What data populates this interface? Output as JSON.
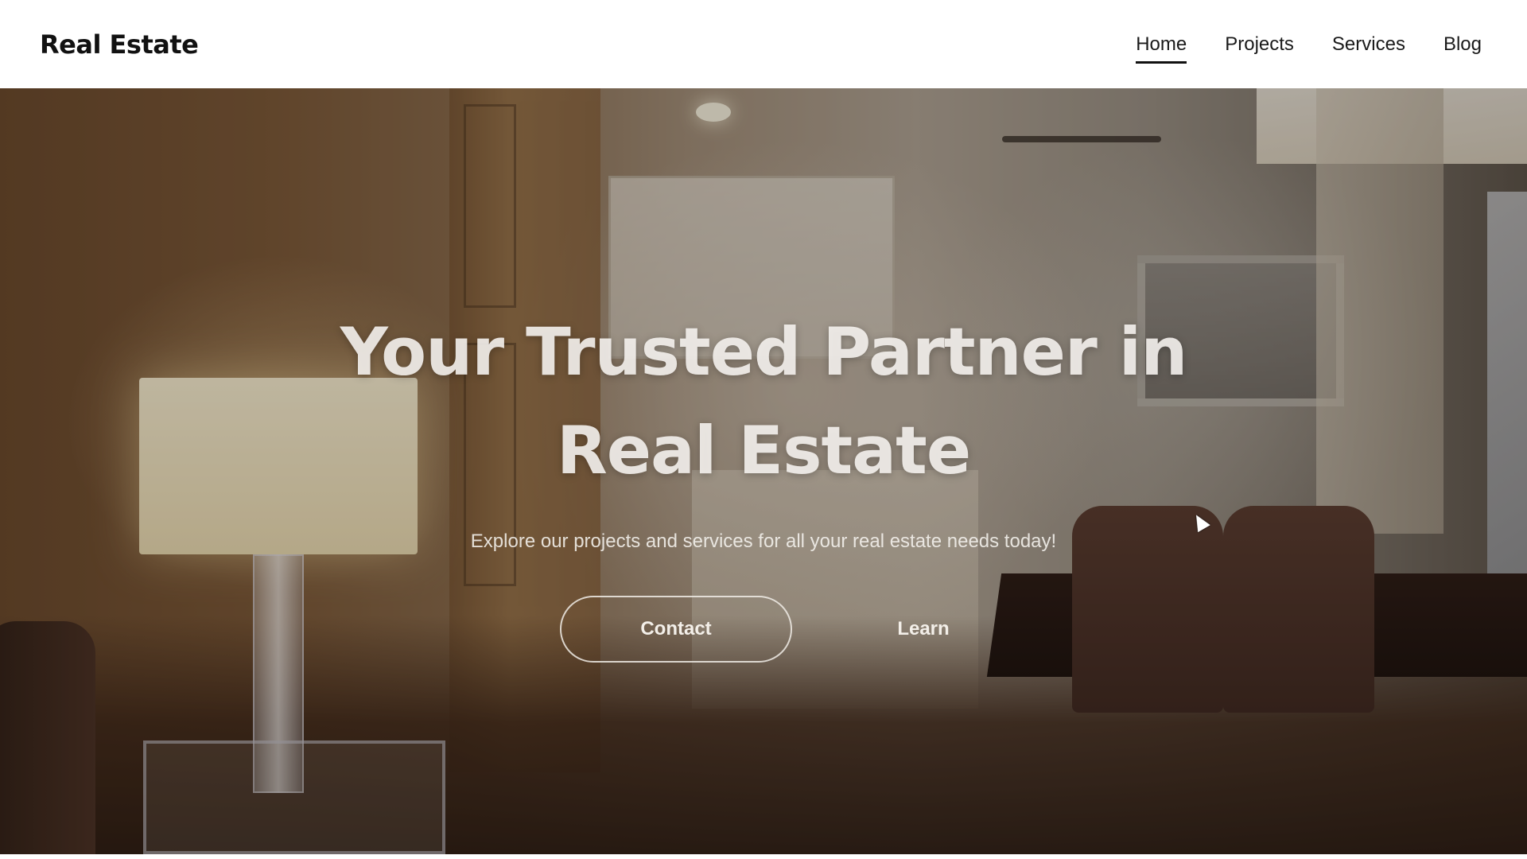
{
  "header": {
    "logo": "Real Estate",
    "nav": [
      {
        "label": "Home",
        "active": true
      },
      {
        "label": "Projects",
        "active": false
      },
      {
        "label": "Services",
        "active": false
      },
      {
        "label": "Blog",
        "active": false
      }
    ]
  },
  "hero": {
    "title": "Your Trusted Partner in Real Estate",
    "subtitle": "Explore our projects and services for all your real estate needs today!",
    "contact_label": "Contact",
    "learn_label": "Learn"
  },
  "icons": {
    "cursor": "mouse-pointer-icon"
  }
}
